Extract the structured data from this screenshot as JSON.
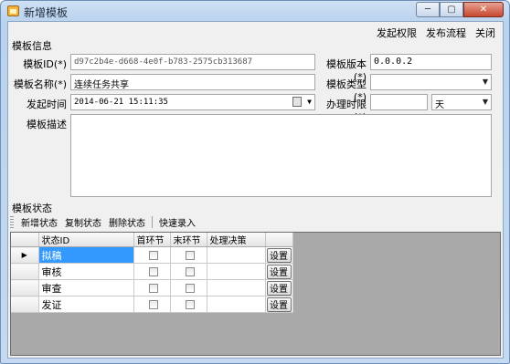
{
  "window": {
    "title": "新增模板"
  },
  "topmenu": {
    "items": [
      "发起权限",
      "发布流程",
      "关闭"
    ]
  },
  "info": {
    "section_label": "模板信息",
    "template_id_label": "模板ID(*)",
    "template_id_value": "d97c2b4e-d668-4e0f-b783-2575cb313687",
    "template_version_label": "模板版本(*)",
    "template_version_value": "0.0.0.2",
    "template_name_label": "模板名称(*)",
    "template_name_value": "连续任务共享",
    "template_type_label": "模板类型(*)",
    "template_type_value": "",
    "start_time_label": "发起时间",
    "start_time_value": "2014-06-21 15:11:35",
    "time_limit_label": "办理时限(*)",
    "time_limit_value": "",
    "time_unit_value": "天",
    "description_label": "模板描述",
    "description_value": ""
  },
  "status": {
    "section_label": "模板状态",
    "toolbar": [
      "新增状态",
      "复制状态",
      "删除状态",
      "快速录入"
    ],
    "columns": [
      "状态ID",
      "首环节",
      "末环节",
      "处理决策"
    ],
    "rows": [
      {
        "name": "拟稿",
        "first": false,
        "last": false,
        "decision": "",
        "button": "设置",
        "selected": true
      },
      {
        "name": "审核",
        "first": false,
        "last": false,
        "decision": "",
        "button": "设置",
        "selected": false
      },
      {
        "name": "审查",
        "first": false,
        "last": false,
        "decision": "",
        "button": "设置",
        "selected": false
      },
      {
        "name": "发证",
        "first": false,
        "last": false,
        "decision": "",
        "button": "设置",
        "selected": false
      }
    ]
  }
}
